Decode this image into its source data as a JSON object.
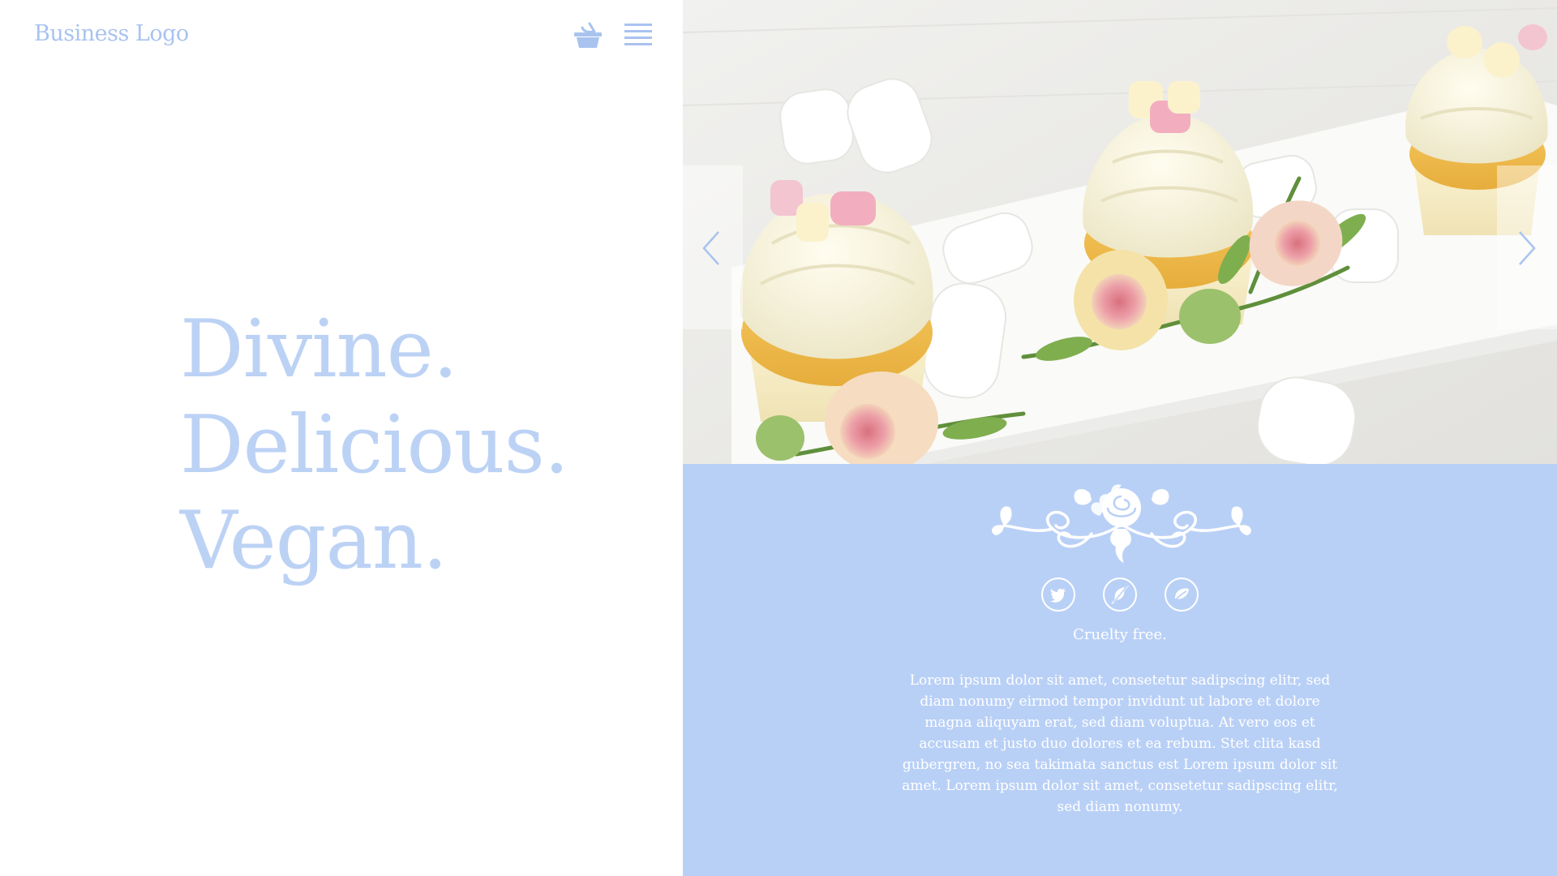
{
  "header": {
    "logo_text": "Business Logo",
    "basket_icon": "basket-icon",
    "menu_icon": "hamburger-menu-icon"
  },
  "hero": {
    "lines": [
      "Divine.",
      "Delicious.",
      "Vegan."
    ]
  },
  "carousel": {
    "image_description": "cupcakes-with-marshmallows-and-roses",
    "prev_icon": "chevron-left-icon",
    "next_icon": "chevron-right-icon"
  },
  "info": {
    "ornament": "rose-flourish-ornament",
    "icons": [
      "twitter-icon",
      "no-leaf-icon",
      "leaf-icon"
    ],
    "tagline": "Cruelty free.",
    "body": "Lorem ipsum dolor sit amet, consetetur sadipscing elitr, sed diam nonumy eirmod tempor invidunt ut labore et dolore magna aliquyam erat, sed diam voluptua. At vero eos et accusam et justo duo dolores et ea rebum. Stet clita kasd gubergren, no sea takimata sanctus est Lorem ipsum dolor sit amet. Lorem ipsum dolor sit amet, consetetur sadipscing elitr, sed diam nonumy."
  },
  "colors": {
    "accent_blue": "#b9d0f6",
    "logo_blue": "#a9c3ef",
    "hero_text": "#bcd2f5",
    "white": "#ffffff"
  }
}
